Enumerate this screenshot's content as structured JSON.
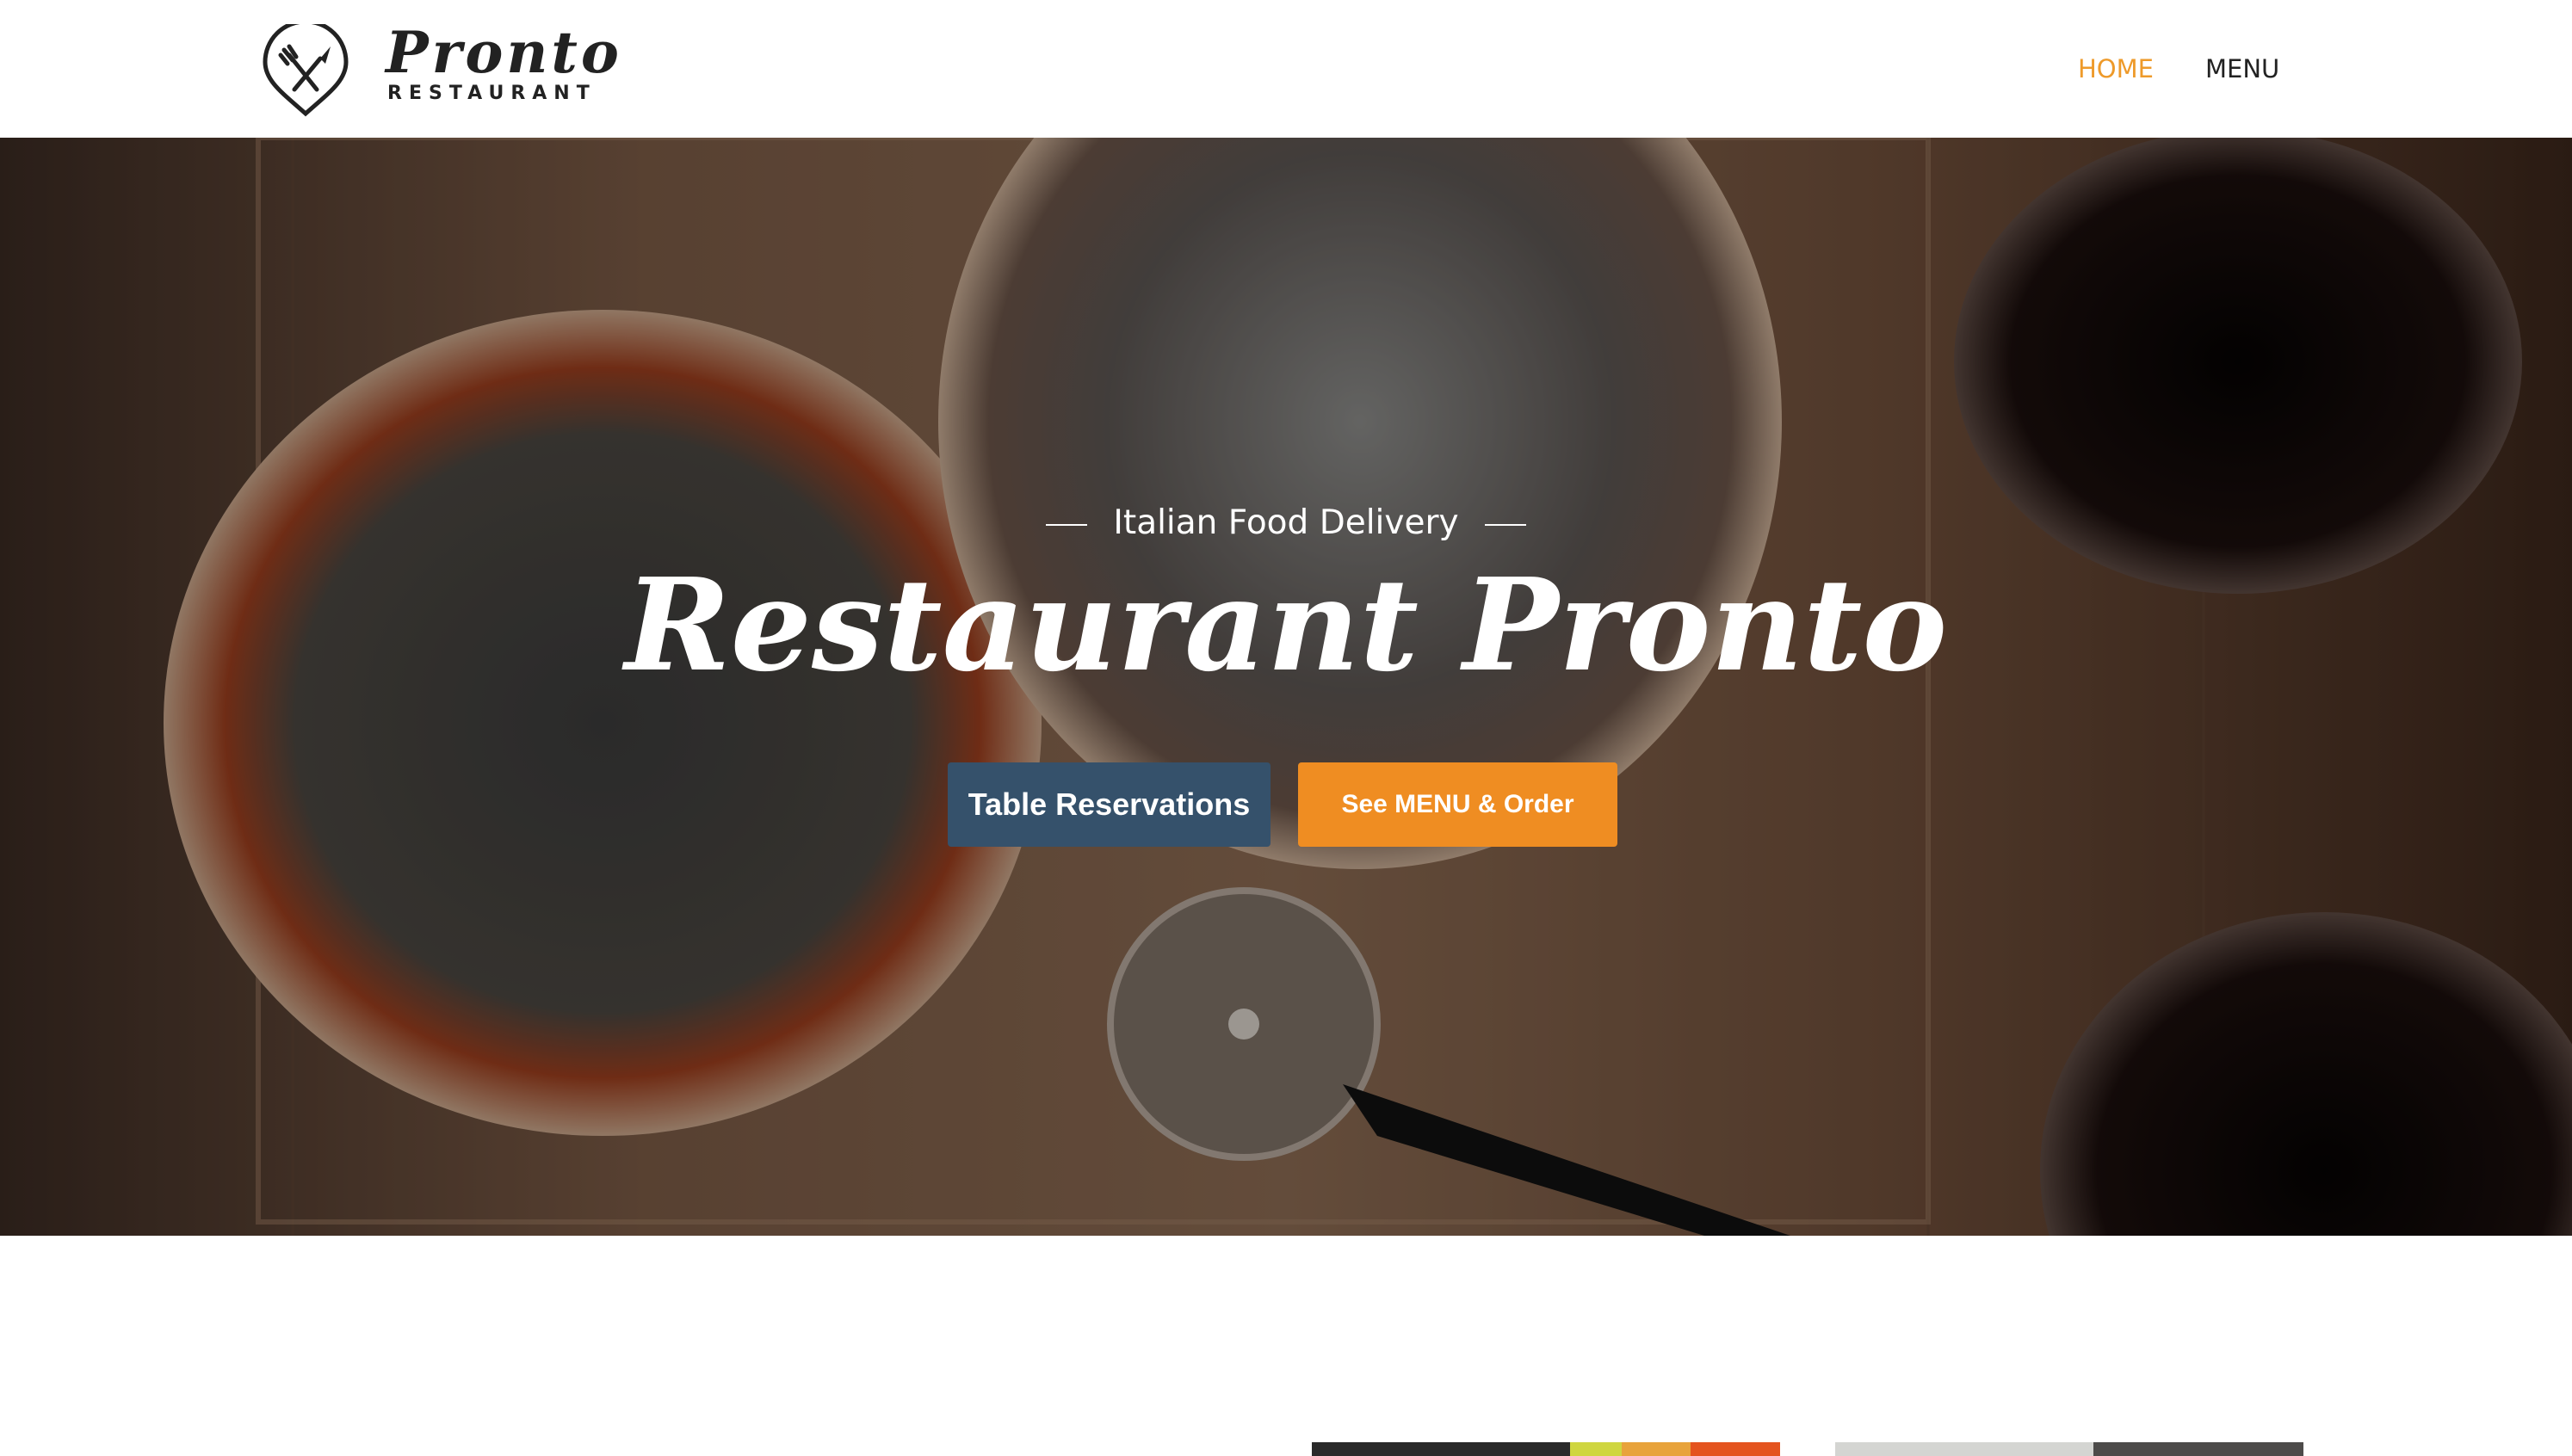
{
  "colors": {
    "accent": "#ee9a2a",
    "nav_text": "#222222",
    "reserve_button": "#35516b",
    "order_button": "#ef8d22",
    "hero_text": "#ffffff"
  },
  "header": {
    "logo_icon": "fork-knife-pin-icon",
    "logo_title": "Pronto",
    "logo_subtitle": "RESTAURANT",
    "nav": [
      {
        "label": "HOME",
        "active": true
      },
      {
        "label": "MENU",
        "active": false
      }
    ]
  },
  "hero": {
    "background": "pizzas-on-cutting-board-with-wine-glasses-photo",
    "eyebrow": "Italian Food Delivery",
    "title": "Restaurant Pronto",
    "buttons": {
      "reserve_label": "Table Reservations",
      "order_label": "See MENU & Order"
    }
  },
  "gallery": {
    "thumbnails": [
      "food-photo",
      "kitchen-photo"
    ]
  }
}
